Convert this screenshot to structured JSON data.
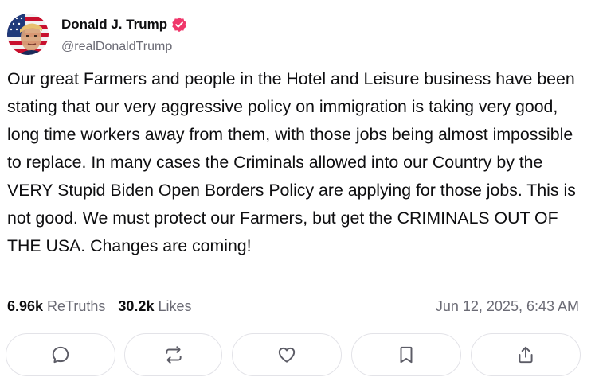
{
  "post": {
    "author": {
      "name": "Donald J. Trump",
      "handle": "@realDonaldTrump",
      "verified": true,
      "verified_color": "#f0386b",
      "avatar_icon": "flag-portrait-avatar"
    },
    "content": "Our great Farmers and people in the Hotel and Leisure business have been stating that our very aggressive policy on immigration is taking very good, long time workers away from them, with those jobs being almost impossible to replace. In many cases the Criminals allowed into our Country by the VERY Stupid Biden Open Borders Policy are applying for those jobs. This is not good. We must protect our Farmers, but get the CRIMINALS OUT OF THE USA. Changes are coming!",
    "stats": {
      "retruths_count": "6.96k",
      "retruths_label": "ReTruths",
      "likes_count": "30.2k",
      "likes_label": "Likes"
    },
    "timestamp": "Jun 12, 2025, 6:43 AM",
    "actions": [
      {
        "name": "reply",
        "icon": "comment-icon"
      },
      {
        "name": "retruth",
        "icon": "repost-icon"
      },
      {
        "name": "like",
        "icon": "heart-icon"
      },
      {
        "name": "bookmark",
        "icon": "bookmark-icon"
      },
      {
        "name": "share",
        "icon": "share-icon"
      }
    ]
  }
}
